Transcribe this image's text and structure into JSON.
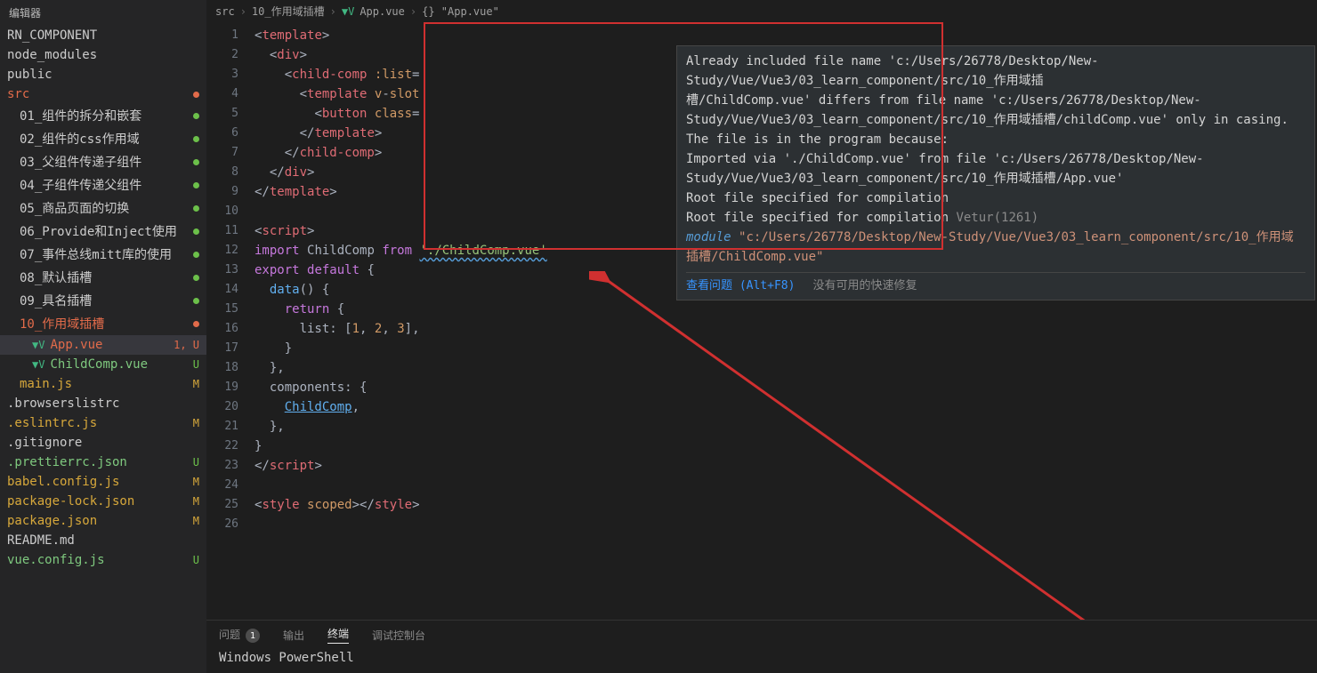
{
  "sidebar": {
    "title": "编辑器",
    "section": "RN_COMPONENT",
    "items": [
      {
        "label": "node_modules",
        "indent": 0,
        "name": "white",
        "status": ""
      },
      {
        "label": "public",
        "indent": 0,
        "name": "white",
        "status": ""
      },
      {
        "label": "src",
        "indent": 0,
        "name": "red",
        "status": "dot-red"
      },
      {
        "label": "01_组件的拆分和嵌套",
        "indent": 1,
        "name": "white",
        "status": "dot-green"
      },
      {
        "label": "02_组件的css作用域",
        "indent": 1,
        "name": "white",
        "status": "dot-green"
      },
      {
        "label": "03_父组件传递子组件",
        "indent": 1,
        "name": "white",
        "status": "dot-green"
      },
      {
        "label": "04_子组件传递父组件",
        "indent": 1,
        "name": "white",
        "status": "dot-green"
      },
      {
        "label": "05_商品页面的切换",
        "indent": 1,
        "name": "white",
        "status": "dot-green"
      },
      {
        "label": "06_Provide和Inject使用",
        "indent": 1,
        "name": "white",
        "status": "dot-green"
      },
      {
        "label": "07_事件总线mitt库的使用",
        "indent": 1,
        "name": "white",
        "status": "dot-green"
      },
      {
        "label": "08_默认插槽",
        "indent": 1,
        "name": "white",
        "status": "dot-green"
      },
      {
        "label": "09_具名插槽",
        "indent": 1,
        "name": "white",
        "status": "dot-green"
      },
      {
        "label": "10_作用域插槽",
        "indent": 1,
        "name": "red",
        "status": "dot-red"
      },
      {
        "label": "App.vue",
        "indent": 2,
        "name": "red",
        "status": "1, U",
        "icon": "vue",
        "selected": true
      },
      {
        "label": "ChildComp.vue",
        "indent": 2,
        "name": "green",
        "status": "U",
        "icon": "vue"
      },
      {
        "label": "main.js",
        "indent": 1,
        "name": "yellow",
        "status": "M"
      },
      {
        "label": ".browserslistrc",
        "indent": 0,
        "name": "white",
        "status": ""
      },
      {
        "label": ".eslintrc.js",
        "indent": 0,
        "name": "yellow",
        "status": "M"
      },
      {
        "label": ".gitignore",
        "indent": 0,
        "name": "white",
        "status": ""
      },
      {
        "label": ".prettierrc.json",
        "indent": 0,
        "name": "green",
        "status": "U"
      },
      {
        "label": "babel.config.js",
        "indent": 0,
        "name": "yellow",
        "status": "M"
      },
      {
        "label": "package-lock.json",
        "indent": 0,
        "name": "yellow",
        "status": "M"
      },
      {
        "label": "package.json",
        "indent": 0,
        "name": "yellow",
        "status": "M"
      },
      {
        "label": "README.md",
        "indent": 0,
        "name": "white",
        "status": ""
      },
      {
        "label": "vue.config.js",
        "indent": 0,
        "name": "green",
        "status": "U"
      }
    ]
  },
  "breadcrumb": {
    "parts": [
      "src",
      "10_作用域插槽",
      "App.vue",
      "{} \"App.vue\""
    ],
    "vue_icon_index": 2
  },
  "code": {
    "lines": [
      {
        "n": 1,
        "html": "<span class='tok-punc'>&lt;</span><span class='tok-tag'>template</span><span class='tok-punc'>&gt;</span>"
      },
      {
        "n": 2,
        "html": "  <span class='tok-punc'>&lt;</span><span class='tok-tag'>div</span><span class='tok-punc'>&gt;</span>"
      },
      {
        "n": 3,
        "html": "    <span class='tok-punc'>&lt;</span><span class='tok-tag'>child-comp</span> <span class='tok-attr'>:list</span><span class='tok-punc'>=</span>"
      },
      {
        "n": 4,
        "html": "      <span class='tok-punc'>&lt;</span><span class='tok-tag'>template</span> <span class='tok-attr'>v</span><span class='tok-punc'>-</span><span class='tok-attr'>slot</span>"
      },
      {
        "n": 5,
        "html": "        <span class='tok-punc'>&lt;</span><span class='tok-tag'>button</span> <span class='tok-attr'>c</span><span class='tok-attr'>lass</span><span class='tok-punc'>=</span>"
      },
      {
        "n": 6,
        "html": "      <span class='tok-punc'>&lt;/</span><span class='tok-tag'>template</span><span class='tok-punc'>&gt;</span>"
      },
      {
        "n": 7,
        "html": "    <span class='tok-punc'>&lt;/</span><span class='tok-tag'>child-comp</span><span class='tok-punc'>&gt;</span>"
      },
      {
        "n": 8,
        "html": "  <span class='tok-punc'>&lt;/</span><span class='tok-tag'>div</span><span class='tok-punc'>&gt;</span>"
      },
      {
        "n": 9,
        "html": "<span class='tok-punc'>&lt;/</span><span class='tok-tag'>template</span><span class='tok-punc'>&gt;</span>"
      },
      {
        "n": 10,
        "html": ""
      },
      {
        "n": 11,
        "html": "<span class='tok-punc'>&lt;</span><span class='tok-tag'>script</span><span class='tok-punc'>&gt;</span>"
      },
      {
        "n": 12,
        "html": "<span class='tok-kw'>import</span> <span class='tok-txt'>ChildComp</span> <span class='tok-kw'>from</span> <span class='tok-under'>'./ChildComp.vue'</span>"
      },
      {
        "n": 13,
        "html": "<span class='tok-kw'>export</span> <span class='tok-kw'>default</span> <span class='tok-punc'>{</span>"
      },
      {
        "n": 14,
        "html": "  <span class='tok-blue'>data</span><span class='tok-punc'>() {</span>"
      },
      {
        "n": 15,
        "html": "    <span class='tok-kw'>return</span> <span class='tok-punc'>{</span>"
      },
      {
        "n": 16,
        "html": "      <span class='tok-txt'>list</span><span class='tok-punc'>:</span> <span class='tok-punc'>[</span><span class='tok-num'>1</span><span class='tok-punc'>,</span> <span class='tok-num'>2</span><span class='tok-punc'>,</span> <span class='tok-num'>3</span><span class='tok-punc'>],</span>"
      },
      {
        "n": 17,
        "html": "    <span class='tok-punc'>}</span>"
      },
      {
        "n": 18,
        "html": "  <span class='tok-punc'>},</span>"
      },
      {
        "n": 19,
        "html": "  <span class='tok-txt'>components</span><span class='tok-punc'>:</span> <span class='tok-punc'>{</span>"
      },
      {
        "n": 20,
        "html": "    <span class='tok-blue' style='text-decoration:underline'>ChildComp</span><span class='tok-punc'>,</span>"
      },
      {
        "n": 21,
        "html": "  <span class='tok-punc'>},</span>"
      },
      {
        "n": 22,
        "html": "<span class='tok-punc'>}</span>"
      },
      {
        "n": 23,
        "html": "<span class='tok-punc'>&lt;/</span><span class='tok-tag'>script</span><span class='tok-punc'>&gt;</span>"
      },
      {
        "n": 24,
        "html": ""
      },
      {
        "n": 25,
        "html": "<span class='tok-punc'>&lt;</span><span class='tok-tag'>style</span> <span class='tok-attr'>scoped</span><span class='tok-punc'>&gt;&lt;/</span><span class='tok-tag'>style</span><span class='tok-punc'>&gt;</span>"
      },
      {
        "n": 26,
        "html": ""
      }
    ]
  },
  "hover": {
    "lines": [
      "Already included file name 'c:/Users/26778/Desktop/New-Study/Vue/Vue3/03_learn_component/src/10_作用域插",
      "槽/ChildComp.vue' differs from file name 'c:/Users/26778/Desktop/New-",
      "Study/Vue/Vue3/03_learn_component/src/10_作用域插槽/childComp.vue' only in casing.",
      "  The file is in the program because:",
      "    Imported via './ChildComp.vue' from file 'c:/Users/26778/Desktop/New-",
      "Study/Vue/Vue3/03_learn_component/src/10_作用域插槽/App.vue'",
      "    Root file specified for compilation",
      "    Root file specified for compilation"
    ],
    "vetur": "Vetur(1261)",
    "module_kw": "module",
    "module_path": "\"c:/Users/26778/Desktop/New-Study/Vue/Vue3/03_learn_component/src/10_作用域插槽/ChildComp.vue\"",
    "action_link": "查看问题 (Alt+F8)",
    "action_muted": "没有可用的快速修复"
  },
  "panel": {
    "tabs": [
      {
        "label": "问题",
        "badge": "1"
      },
      {
        "label": "输出"
      },
      {
        "label": "终端",
        "active": true
      },
      {
        "label": "调试控制台"
      }
    ],
    "terminal_line": "Windows PowerShell"
  }
}
